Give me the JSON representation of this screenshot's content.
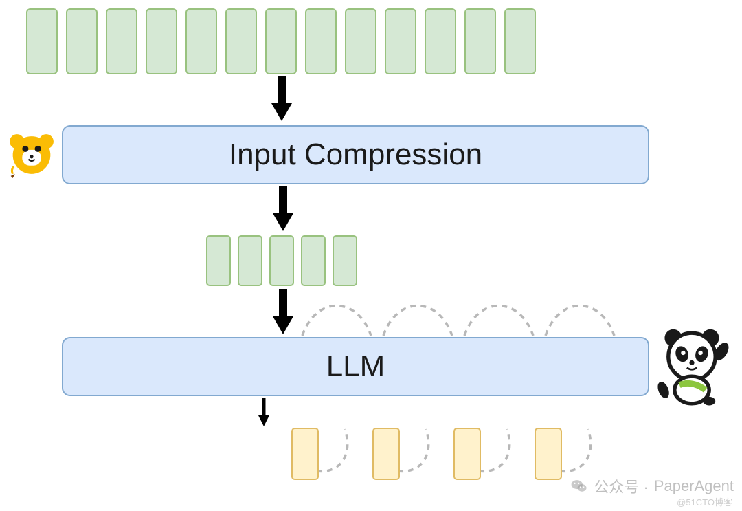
{
  "diagram": {
    "input_token_count": 13,
    "compressed_token_count": 5,
    "output_token_count": 4,
    "box1_label": "Input Compression",
    "box2_label": "LLM"
  },
  "icons": {
    "left": "lion-icon",
    "right": "panda-icon"
  },
  "watermark": {
    "prefix": "公众号 · ",
    "name": "PaperAgent",
    "sub": "@51CTO博客"
  },
  "colors": {
    "token_green_fill": "#d5e8d4",
    "token_green_stroke": "#99c27f",
    "box_fill": "#dae8fc",
    "box_stroke": "#82a9d0",
    "output_fill": "#fff2cc",
    "output_stroke": "#e0bb64",
    "dashed_stroke": "#b8b8b8"
  }
}
